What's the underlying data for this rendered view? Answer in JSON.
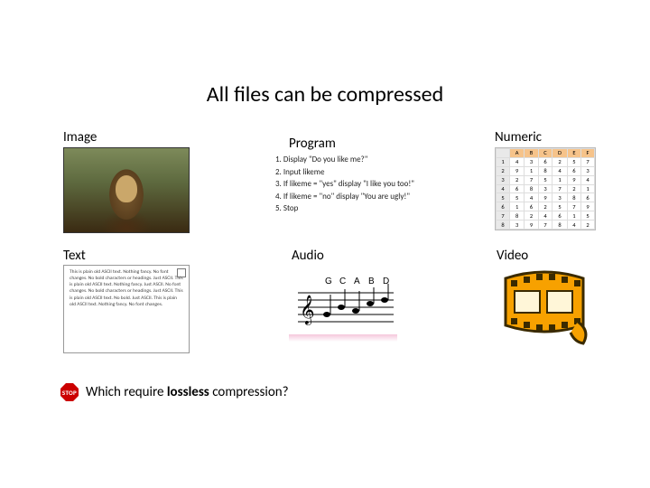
{
  "title": "All files can be compressed",
  "sections": {
    "image": {
      "label": "Image"
    },
    "program": {
      "label": "Program",
      "lines": [
        "1. Display \"Do you like me?\"",
        "2. Input likeme",
        "3. If likeme = \"yes\" display \"I like you too!\"",
        "4. If likeme = \"no\" display \"You are ugly!\"",
        "5. Stop"
      ]
    },
    "numeric": {
      "label": "Numeric",
      "cols": [
        "A",
        "B",
        "C",
        "D",
        "E",
        "F"
      ],
      "rows": [
        [
          "1",
          "4",
          "3",
          "6",
          "2",
          "5",
          "7"
        ],
        [
          "2",
          "9",
          "1",
          "8",
          "4",
          "6",
          "3"
        ],
        [
          "3",
          "2",
          "7",
          "5",
          "1",
          "9",
          "4"
        ],
        [
          "4",
          "6",
          "8",
          "3",
          "7",
          "2",
          "1"
        ],
        [
          "5",
          "5",
          "4",
          "9",
          "3",
          "8",
          "6"
        ],
        [
          "6",
          "1",
          "6",
          "2",
          "5",
          "7",
          "9"
        ],
        [
          "7",
          "8",
          "2",
          "4",
          "6",
          "1",
          "5"
        ],
        [
          "8",
          "3",
          "9",
          "7",
          "8",
          "4",
          "2"
        ]
      ]
    },
    "text": {
      "label": "Text",
      "body": "This is plain old ASCII text. Nothing fancy. No font changes. No bold characters or headings. Just ASCII. This is plain old ASCII text. Nothing fancy. Just ASCII. No font changes. No bold characters or headings. Just ASCII. This is plain old ASCII text. No bold. Just ASCII. This is plain old ASCII text. Nothing fancy. No font changes."
    },
    "audio": {
      "label": "Audio",
      "chord_letters": [
        "G",
        "C",
        "A",
        "B",
        "D"
      ]
    },
    "video": {
      "label": "Video"
    }
  },
  "stop_icon_text": "STOP",
  "question_prefix": "Which require ",
  "question_emph": "lossless",
  "question_suffix": " compression?"
}
